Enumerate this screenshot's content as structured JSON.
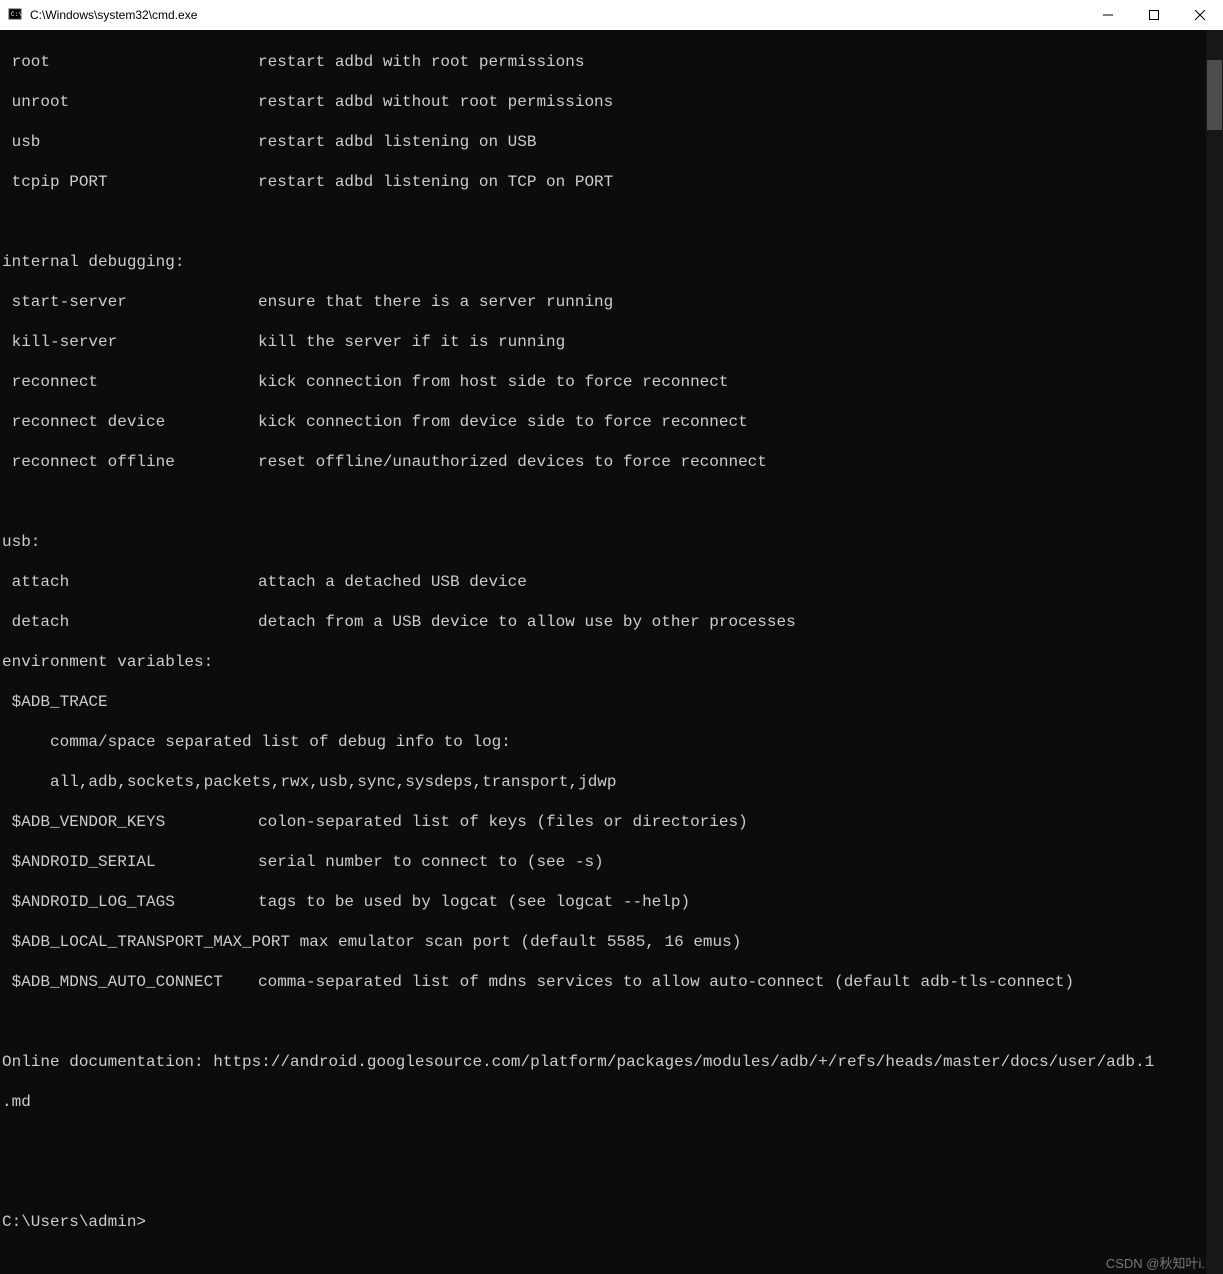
{
  "window": {
    "title": "C:\\Windows\\system32\\cmd.exe"
  },
  "lines": {
    "l1_cmd": " root",
    "l1_desc": "restart adbd with root permissions",
    "l2_cmd": " unroot",
    "l2_desc": "restart adbd without root permissions",
    "l3_cmd": " usb",
    "l3_desc": "restart adbd listening on USB",
    "l4_cmd": " tcpip PORT",
    "l4_desc": "restart adbd listening on TCP on PORT",
    "blank1": " ",
    "sec1": "internal debugging:",
    "l5_cmd": " start-server",
    "l5_desc": "ensure that there is a server running",
    "l6_cmd": " kill-server",
    "l6_desc": "kill the server if it is running",
    "l7_cmd": " reconnect",
    "l7_desc": "kick connection from host side to force reconnect",
    "l8_cmd": " reconnect device",
    "l8_desc": "kick connection from device side to force reconnect",
    "l9_cmd": " reconnect offline",
    "l9_desc": "reset offline/unauthorized devices to force reconnect",
    "blank2": " ",
    "sec2": "usb:",
    "l10_cmd": " attach",
    "l10_desc": "attach a detached USB device",
    "l11_cmd": " detach",
    "l11_desc": "detach from a USB device to allow use by other processes",
    "sec3": "environment variables:",
    "env1": " $ADB_TRACE",
    "env1a": "     comma/space separated list of debug info to log:",
    "env1b": "     all,adb,sockets,packets,rwx,usb,sync,sysdeps,transport,jdwp",
    "env2_cmd": " $ADB_VENDOR_KEYS",
    "env2_desc": "colon-separated list of keys (files or directories)",
    "env3_cmd": " $ANDROID_SERIAL",
    "env3_desc": "serial number to connect to (see -s)",
    "env4_cmd": " $ANDROID_LOG_TAGS",
    "env4_desc": "tags to be used by logcat (see logcat --help)",
    "env5": " $ADB_LOCAL_TRANSPORT_MAX_PORT max emulator scan port (default 5585, 16 emus)",
    "env6_cmd": " $ADB_MDNS_AUTO_CONNECT",
    "env6_desc": "comma-separated list of mdns services to allow auto-connect (default adb-tls-connect)",
    "blank3": " ",
    "doc1": "Online documentation: https://android.googlesource.com/platform/packages/modules/adb/+/refs/heads/master/docs/user/adb.1",
    "doc2": ".md",
    "blank4": " ",
    "blank5": " ",
    "prompt": "C:\\Users\\admin>"
  },
  "watermark": "CSDN @秋知叶i."
}
